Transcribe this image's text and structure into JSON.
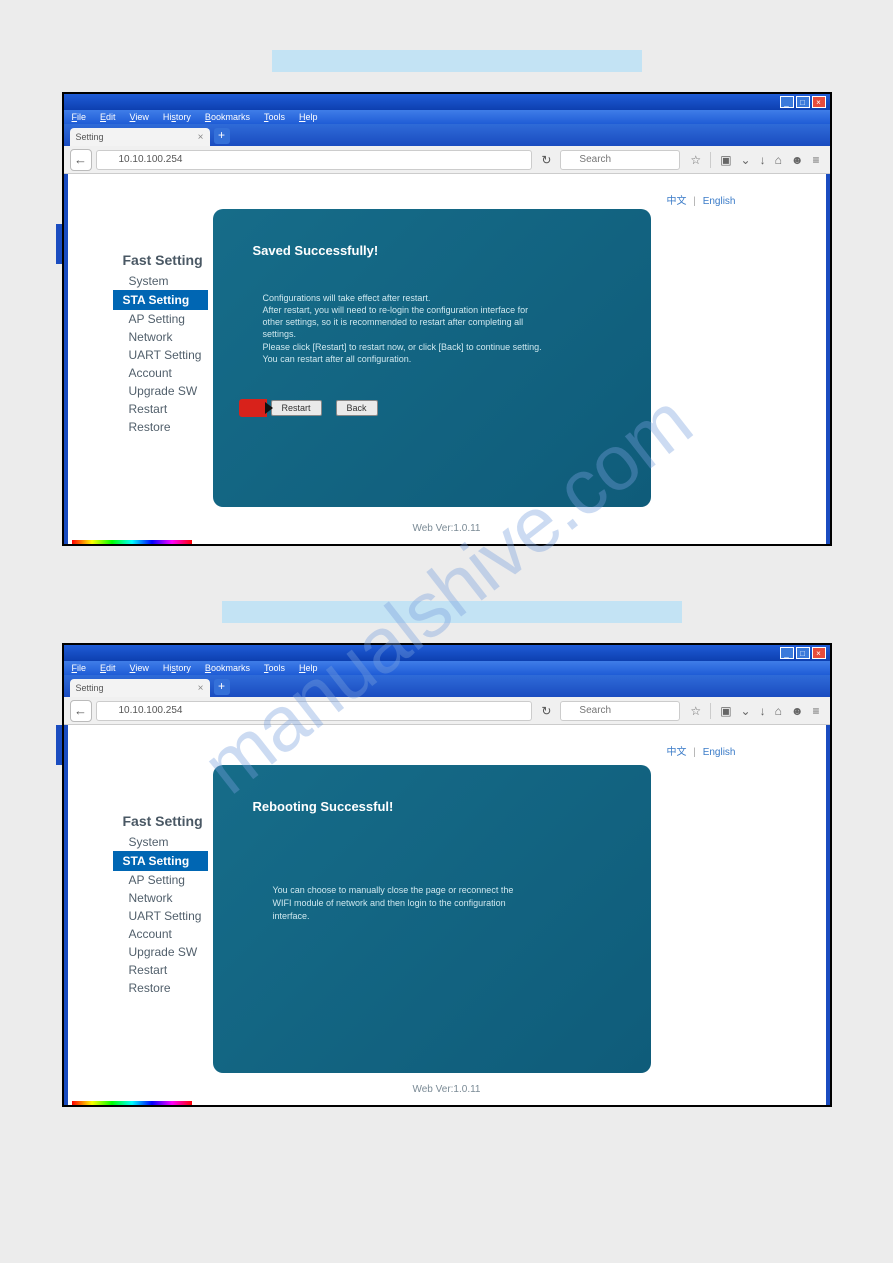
{
  "watermark": "manualshive.com",
  "menubar": {
    "file": "File",
    "edit": "Edit",
    "view": "View",
    "history": "History",
    "bookmarks": "Bookmarks",
    "tools": "Tools",
    "help": "Help"
  },
  "tab": {
    "label": "Setting"
  },
  "urlbar": {
    "url": "10.10.100.254",
    "search_placeholder": "Search"
  },
  "lang": {
    "zh": "中文",
    "en": "English"
  },
  "sidebar": {
    "title": "Fast Setting",
    "items": [
      "System",
      "STA Setting",
      "AP Setting",
      "Network",
      "UART Setting",
      "Account",
      "Upgrade SW",
      "Restart",
      "Restore"
    ],
    "active": "STA Setting"
  },
  "panel1": {
    "title": "Saved Successfully!",
    "line1": "Configurations will take effect after restart.",
    "line2": "After restart, you will need to re-login the configuration interface for other settings, so it is recommended to restart after completing all settings.",
    "line3": "Please click [Restart] to restart now, or click [Back] to continue setting.",
    "line4": "You can restart after all configuration.",
    "btn_restart": "Restart",
    "btn_back": "Back"
  },
  "panel2": {
    "title": "Rebooting Successful!",
    "text": "You can choose to manually close the page or reconnect the WIFI module of network and then login to the configuration interface."
  },
  "footer": {
    "version": "Web Ver:1.0.11"
  }
}
